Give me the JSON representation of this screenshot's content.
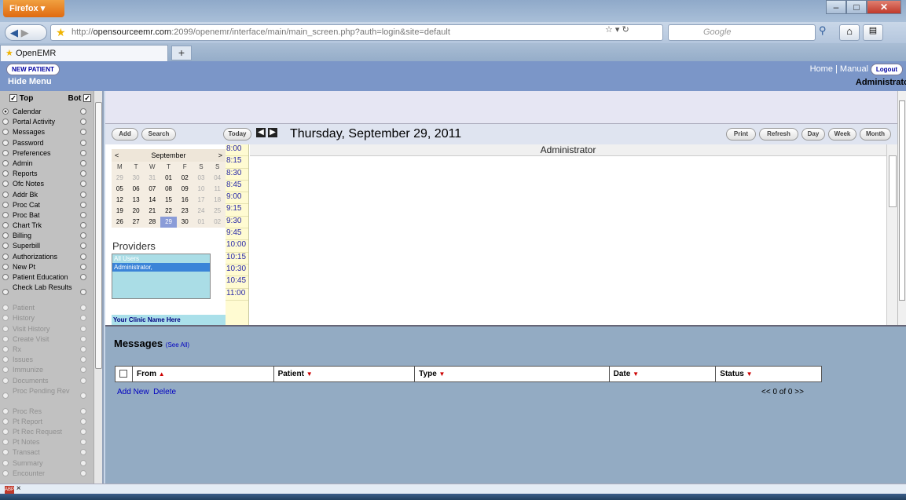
{
  "browser": {
    "menu_button": "Firefox ▾",
    "url_prefix": "http://",
    "url_host": "opensourceemr.com",
    "url_rest": ":2099/openemr/interface/main/main_screen.php?auth=login&site=default",
    "search_placeholder": "Google",
    "tab_title": "OpenEMR",
    "new_tab": "+"
  },
  "header": {
    "new_patient": "NEW PATIENT",
    "hide_menu": "Hide Menu",
    "home": "Home",
    "separator": "|",
    "manual": "Manual",
    "logout": "Logout",
    "user": "Administrator"
  },
  "menu": {
    "top_label": "Top",
    "bot_label": "Bot",
    "items": [
      {
        "label": "Calendar",
        "state": "selected"
      },
      {
        "label": "Portal Activity",
        "state": "normal"
      },
      {
        "label": "Messages",
        "state": "normal"
      },
      {
        "label": "Password",
        "state": "normal"
      },
      {
        "label": "Preferences",
        "state": "normal"
      },
      {
        "label": "Admin",
        "state": "normal"
      },
      {
        "label": "Reports",
        "state": "normal"
      },
      {
        "label": "Ofc Notes",
        "state": "normal"
      },
      {
        "label": "Addr Bk",
        "state": "normal"
      },
      {
        "label": "Proc Cat",
        "state": "normal"
      },
      {
        "label": "Proc Bat",
        "state": "normal"
      },
      {
        "label": "Chart Trk",
        "state": "normal"
      },
      {
        "label": "Billing",
        "state": "normal"
      },
      {
        "label": "Superbill",
        "state": "normal"
      },
      {
        "label": "Authorizations",
        "state": "normal"
      },
      {
        "label": "New Pt",
        "state": "normal"
      },
      {
        "label": "Patient Education",
        "state": "normal"
      },
      {
        "label": "Check Lab Results",
        "state": "normal"
      },
      {
        "label": "Patient",
        "state": "disabled"
      },
      {
        "label": "History",
        "state": "disabled"
      },
      {
        "label": "Visit History",
        "state": "disabled"
      },
      {
        "label": "Create Visit",
        "state": "disabled"
      },
      {
        "label": "Rx",
        "state": "disabled"
      },
      {
        "label": "Issues",
        "state": "disabled"
      },
      {
        "label": "Immunize",
        "state": "disabled"
      },
      {
        "label": "Documents",
        "state": "disabled"
      },
      {
        "label": "Proc Pending Rev",
        "state": "disabled"
      },
      {
        "label": "Proc Res",
        "state": "disabled"
      },
      {
        "label": "Pt Report",
        "state": "disabled"
      },
      {
        "label": "Pt Rec Request",
        "state": "disabled"
      },
      {
        "label": "Pt Notes",
        "state": "disabled"
      },
      {
        "label": "Transact",
        "state": "disabled"
      },
      {
        "label": "Summary",
        "state": "disabled"
      },
      {
        "label": "Encounter",
        "state": "disabled"
      }
    ]
  },
  "calendar": {
    "add": "Add",
    "search": "Search",
    "today": "Today",
    "date_title": "Thursday, September 29, 2011",
    "print": "Print",
    "refresh": "Refresh",
    "day": "Day",
    "week": "Week",
    "month": "Month",
    "provider_column": "Administrator",
    "mini": {
      "prev": "<",
      "month": "September",
      "next": ">",
      "dow": [
        "M",
        "T",
        "W",
        "T",
        "F",
        "S",
        "S"
      ],
      "weeks": [
        [
          "29",
          "30",
          "31",
          "01",
          "02",
          "03",
          "04"
        ],
        [
          "05",
          "06",
          "07",
          "08",
          "09",
          "10",
          "11"
        ],
        [
          "12",
          "13",
          "14",
          "15",
          "16",
          "17",
          "18"
        ],
        [
          "19",
          "20",
          "21",
          "22",
          "23",
          "24",
          "25"
        ],
        [
          "26",
          "27",
          "28",
          "29",
          "30",
          "01",
          "02"
        ]
      ]
    },
    "times": [
      "8:00",
      "8:15",
      "8:30",
      "8:45",
      "9:00",
      "9:15",
      "9:30",
      "9:45",
      "10:00",
      "10:15",
      "10:30",
      "10:45",
      "11:00"
    ],
    "providers_title": "Providers",
    "providers": [
      "All Users",
      "Administrator,"
    ],
    "clinic_name": "Your Clinic Name Here"
  },
  "messages": {
    "title": "Messages",
    "see_all": "(See All)",
    "columns": [
      "From",
      "Patient",
      "Type",
      "Date",
      "Status"
    ],
    "add_new": "Add New",
    "delete": "Delete",
    "pager": "<<  0 of 0  >>"
  }
}
